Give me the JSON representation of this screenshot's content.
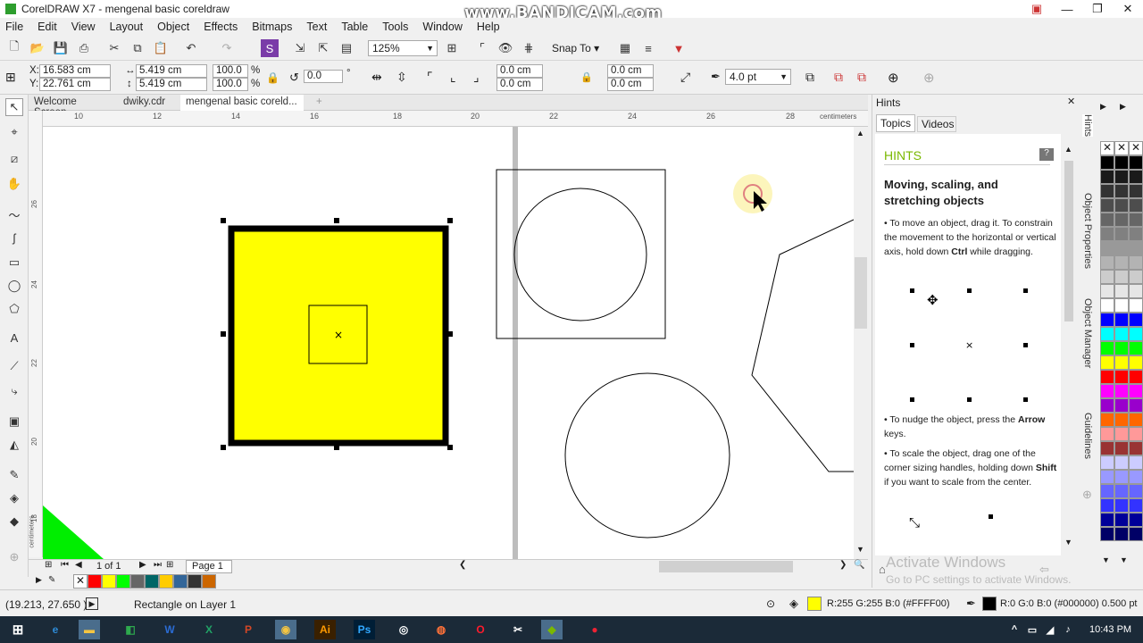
{
  "window": {
    "title": "CorelDRAW X7 - mengenal basic coreldraw",
    "watermark": "www.BANDICAM.com"
  },
  "menu": [
    "File",
    "Edit",
    "View",
    "Layout",
    "Object",
    "Effects",
    "Bitmaps",
    "Text",
    "Table",
    "Tools",
    "Window",
    "Help"
  ],
  "toolbar": {
    "zoom": "125%",
    "snap_to": "Snap To"
  },
  "propbar": {
    "x": "16.583 cm",
    "y": "22.761 cm",
    "x_label": "X:",
    "y_label": "Y:",
    "w": "5.419 cm",
    "h": "5.419 cm",
    "scale_w": "100.0",
    "scale_h": "100.0",
    "pct": "%",
    "angle": "0.0",
    "deg": "°",
    "corner1": "0.0 cm",
    "corner2": "0.0 cm",
    "corner3": "0.0 cm",
    "corner4": "0.0 cm",
    "outline": "4.0 pt"
  },
  "doc_tabs": [
    "Welcome Screen",
    "dwiky.cdr",
    "mengenal basic coreld..."
  ],
  "ruler": {
    "h_ticks": [
      "10",
      "12",
      "14",
      "16",
      "18",
      "20",
      "22",
      "24",
      "26",
      "28"
    ],
    "unit": "centimeters",
    "v_ticks": [
      "26",
      "24",
      "22",
      "20",
      "18"
    ],
    "v_unit": "centimeters"
  },
  "pagebar": {
    "page_count": "1 of 1",
    "page_tab": "Page 1"
  },
  "hints": {
    "dock_title": "Hints",
    "tabs": [
      "Topics",
      "Videos"
    ],
    "header": "HINTS",
    "heading": "Moving, scaling, and stretching objects",
    "p1_pre": "To move an object, drag it. To constrain the movement to the horizontal or vertical axis, hold down ",
    "p1_bold": "Ctrl",
    "p1_post": " while dragging.",
    "p2_pre": "To nudge the object, press the ",
    "p2_bold": "Arrow",
    "p2_post": " keys.",
    "p3_pre": "To scale the object, drag one of the corner sizing handles, holding down ",
    "p3_bold": "Shift",
    "p3_post": " if you want to scale from the center."
  },
  "side_tabs": [
    "Hints",
    "Object Properties",
    "Object Manager",
    "Guidelines"
  ],
  "activate": {
    "line1": "Activate Windows",
    "line2": "Go to PC settings to activate Windows."
  },
  "status": {
    "coords": "(19.213, 27.650 )",
    "object_info": "Rectangle on Layer 1",
    "fill_info": "R:255 G:255 B:0 (#FFFF00)",
    "outline_info": "R:0 G:0 B:0 (#000000)  0.500 pt"
  },
  "taskbar": {
    "time": "10:43 PM"
  },
  "colors": {
    "accent": "#7ab800",
    "fill": "#ffff00",
    "selection": "#000000"
  },
  "palette_colors": [
    "#000000",
    "#1a1a1a",
    "#333333",
    "#4d4d4d",
    "#666666",
    "#808080",
    "#999999",
    "#b3b3b3",
    "#cccccc",
    "#e6e6e6",
    "#ffffff",
    "#0000ff",
    "#00ffff",
    "#00ff00",
    "#ffff00",
    "#ff0000",
    "#ff00ff",
    "#9900cc",
    "#ff6600",
    "#ff9999",
    "#993333",
    "#ccccff",
    "#9999ff",
    "#6666ff",
    "#3333ff",
    "#000099",
    "#000066"
  ],
  "bottom_palette": [
    "#ff0000",
    "#ffff00",
    "#00ff00",
    "#666666",
    "#006666",
    "#ffcc00",
    "#336699",
    "#333333",
    "#cc6600"
  ]
}
